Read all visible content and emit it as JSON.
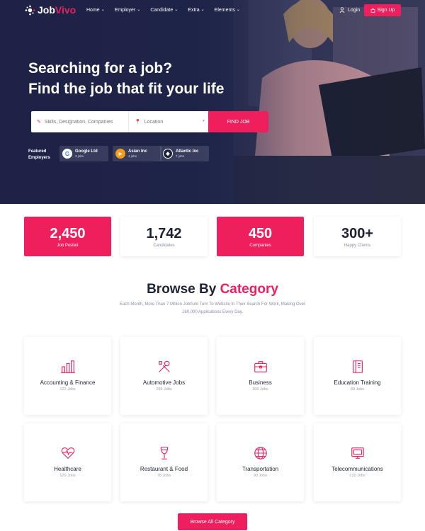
{
  "brand": {
    "logo_part1": "Job",
    "logo_part2": "Vivo",
    "accent": "#ef1f5e",
    "navy": "#1e2235"
  },
  "nav": {
    "items": [
      {
        "label": "Home",
        "icon": "chevron-down-icon"
      },
      {
        "label": "Employer",
        "icon": "chevron-down-icon"
      },
      {
        "label": "Candidate",
        "icon": "chevron-down-icon"
      },
      {
        "label": "Extra",
        "icon": "chevron-down-icon"
      },
      {
        "label": "Elements",
        "icon": "chevron-down-icon"
      }
    ],
    "login": "Login",
    "signup": "Sign Up"
  },
  "hero": {
    "title_line1": "Searching for a job?",
    "title_line2": "Find the job that fit your life"
  },
  "search": {
    "keyword_placeholder": "Skills, Designation, Companies",
    "location_placeholder": "Location",
    "button": "FIND JOB"
  },
  "featured": {
    "label_line1": "Featured",
    "label_line2": "Employers",
    "employers": [
      {
        "name": "Google Ltd",
        "count": "3 jobs",
        "icon": "google-icon"
      },
      {
        "name": "Asian Inc",
        "count": "4 jobs",
        "icon": "asian-inc-icon"
      },
      {
        "name": "Atlantic Inc",
        "count": "7 jobs",
        "icon": "atlantic-inc-icon"
      }
    ]
  },
  "stats": [
    {
      "value": "2,450",
      "label": "Job Posted"
    },
    {
      "value": "1,742",
      "label": "Candidates"
    },
    {
      "value": "450",
      "label": "Companies"
    },
    {
      "value": "300+",
      "label": "Happy Clients"
    }
  ],
  "categories_section": {
    "title_part1": "Browse By",
    "title_part2": "Category",
    "subtitle_line1": "Each Month, More Than 7 Million Jobhunt Turn To Website In Their Search For Work, Making Over",
    "subtitle_line2": "160,000 Applications Every Day.",
    "items": [
      {
        "name": "Accounting & Finance",
        "count": "122 Jobs",
        "icon": "bar-chart-icon"
      },
      {
        "name": "Automotive Jobs",
        "count": "155 Jobs",
        "icon": "tools-icon"
      },
      {
        "name": "Business",
        "count": "300 Jobs",
        "icon": "briefcase-icon"
      },
      {
        "name": "Education Training",
        "count": "80 Jobs",
        "icon": "book-icon"
      },
      {
        "name": "Healthcare",
        "count": "120 Jobs",
        "icon": "heart-pulse-icon"
      },
      {
        "name": "Restaurant & Food",
        "count": "78 Jobs",
        "icon": "wine-glass-icon"
      },
      {
        "name": "Transportation",
        "count": "90 Jobs",
        "icon": "globe-icon"
      },
      {
        "name": "Telecommunications",
        "count": "210 Jobs",
        "icon": "monitor-icon"
      }
    ],
    "browse_all": "Browse All Category"
  }
}
